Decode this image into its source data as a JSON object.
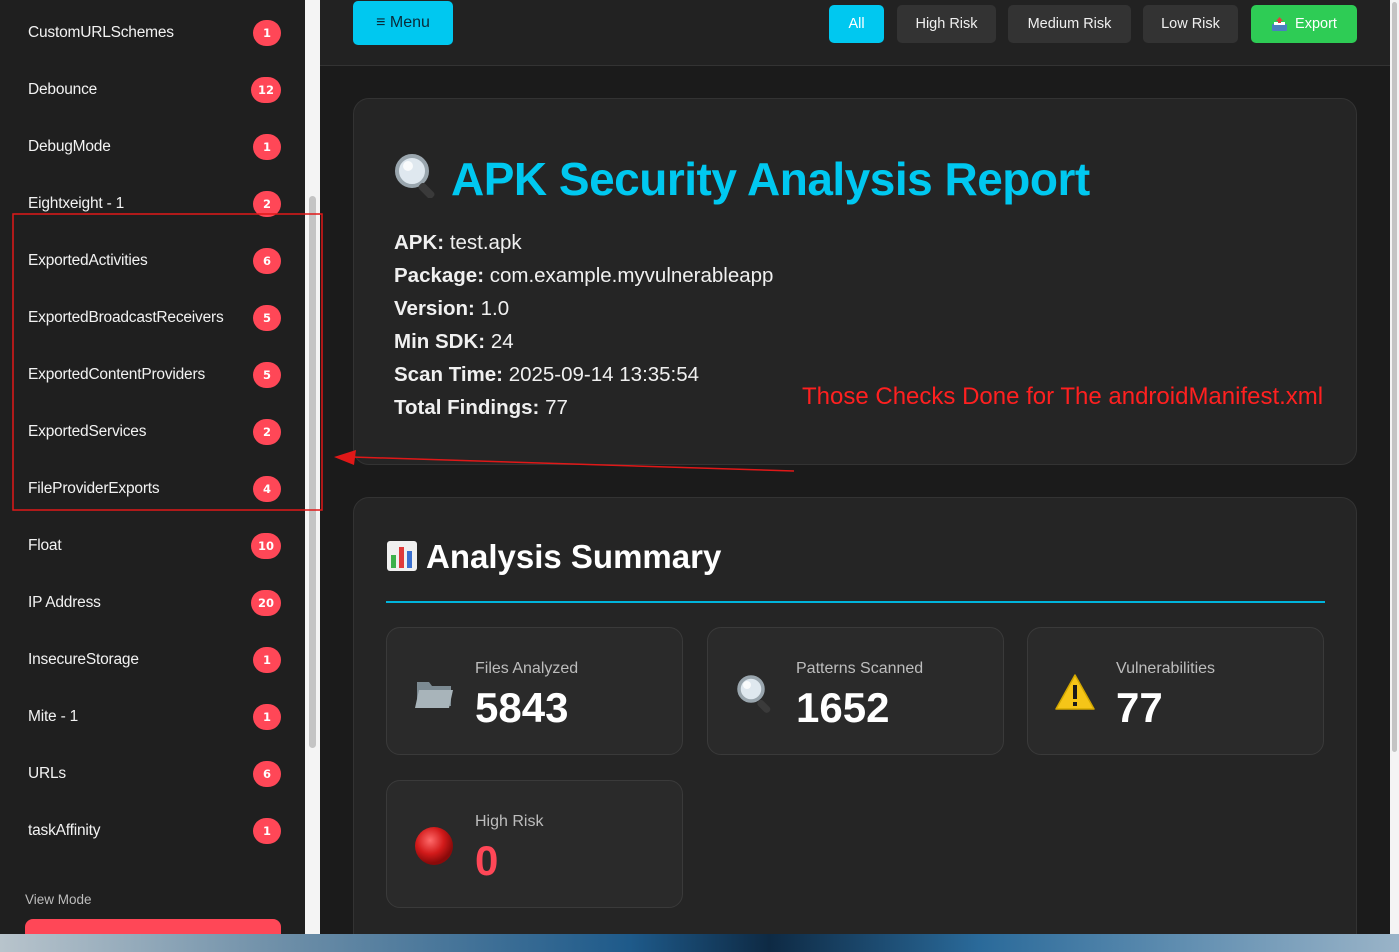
{
  "sidebar": {
    "items": [
      {
        "label": "CustomURLSchemes",
        "count": "1"
      },
      {
        "label": "Debounce",
        "count": "12"
      },
      {
        "label": "DebugMode",
        "count": "1"
      },
      {
        "label": "Eightxeight - 1",
        "count": "2"
      },
      {
        "label": "ExportedActivities",
        "count": "6"
      },
      {
        "label": "ExportedBroadcastReceivers",
        "count": "5"
      },
      {
        "label": "ExportedContentProviders",
        "count": "5"
      },
      {
        "label": "ExportedServices",
        "count": "2"
      },
      {
        "label": "FileProviderExports",
        "count": "4"
      },
      {
        "label": "Float",
        "count": "10"
      },
      {
        "label": "IP Address",
        "count": "20"
      },
      {
        "label": "InsecureStorage",
        "count": "1"
      },
      {
        "label": "Mite - 1",
        "count": "1"
      },
      {
        "label": "URLs",
        "count": "6"
      },
      {
        "label": "taskAffinity",
        "count": "1"
      }
    ],
    "view_mode_label": "View Mode"
  },
  "topbar": {
    "menu_label": "≡ Menu",
    "filters": {
      "all": "All",
      "high": "High Risk",
      "medium": "Medium Risk",
      "low": "Low Risk",
      "export": "Export"
    }
  },
  "report": {
    "title": "APK Security Analysis Report",
    "apk": {
      "label": "APK:",
      "value": "test.apk"
    },
    "package": {
      "label": "Package:",
      "value": "com.example.myvulnerableapp"
    },
    "version": {
      "label": "Version:",
      "value": "1.0"
    },
    "min_sdk": {
      "label": "Min SDK:",
      "value": "24"
    },
    "scan_time": {
      "label": "Scan Time:",
      "value": "2025-09-14 13:35:54"
    },
    "total_findings": {
      "label": "Total Findings:",
      "value": "77"
    }
  },
  "annotation": {
    "text": "Those Checks Done for The androidManifest.xml",
    "color": "#ff2020"
  },
  "summary": {
    "title": "Analysis Summary",
    "stats": [
      {
        "label": "Files Analyzed",
        "value": "5843",
        "icon": "folder-icon"
      },
      {
        "label": "Patterns Scanned",
        "value": "1652",
        "icon": "magnifier-icon"
      },
      {
        "label": "Vulnerabilities",
        "value": "77",
        "icon": "warning-icon"
      },
      {
        "label": "High Risk",
        "value": "0",
        "icon": "red-circle-icon"
      }
    ]
  },
  "colors": {
    "accent": "#00c8f0",
    "badge": "#ff4757",
    "export": "#2ecc55",
    "background": "#1b1b1b"
  }
}
